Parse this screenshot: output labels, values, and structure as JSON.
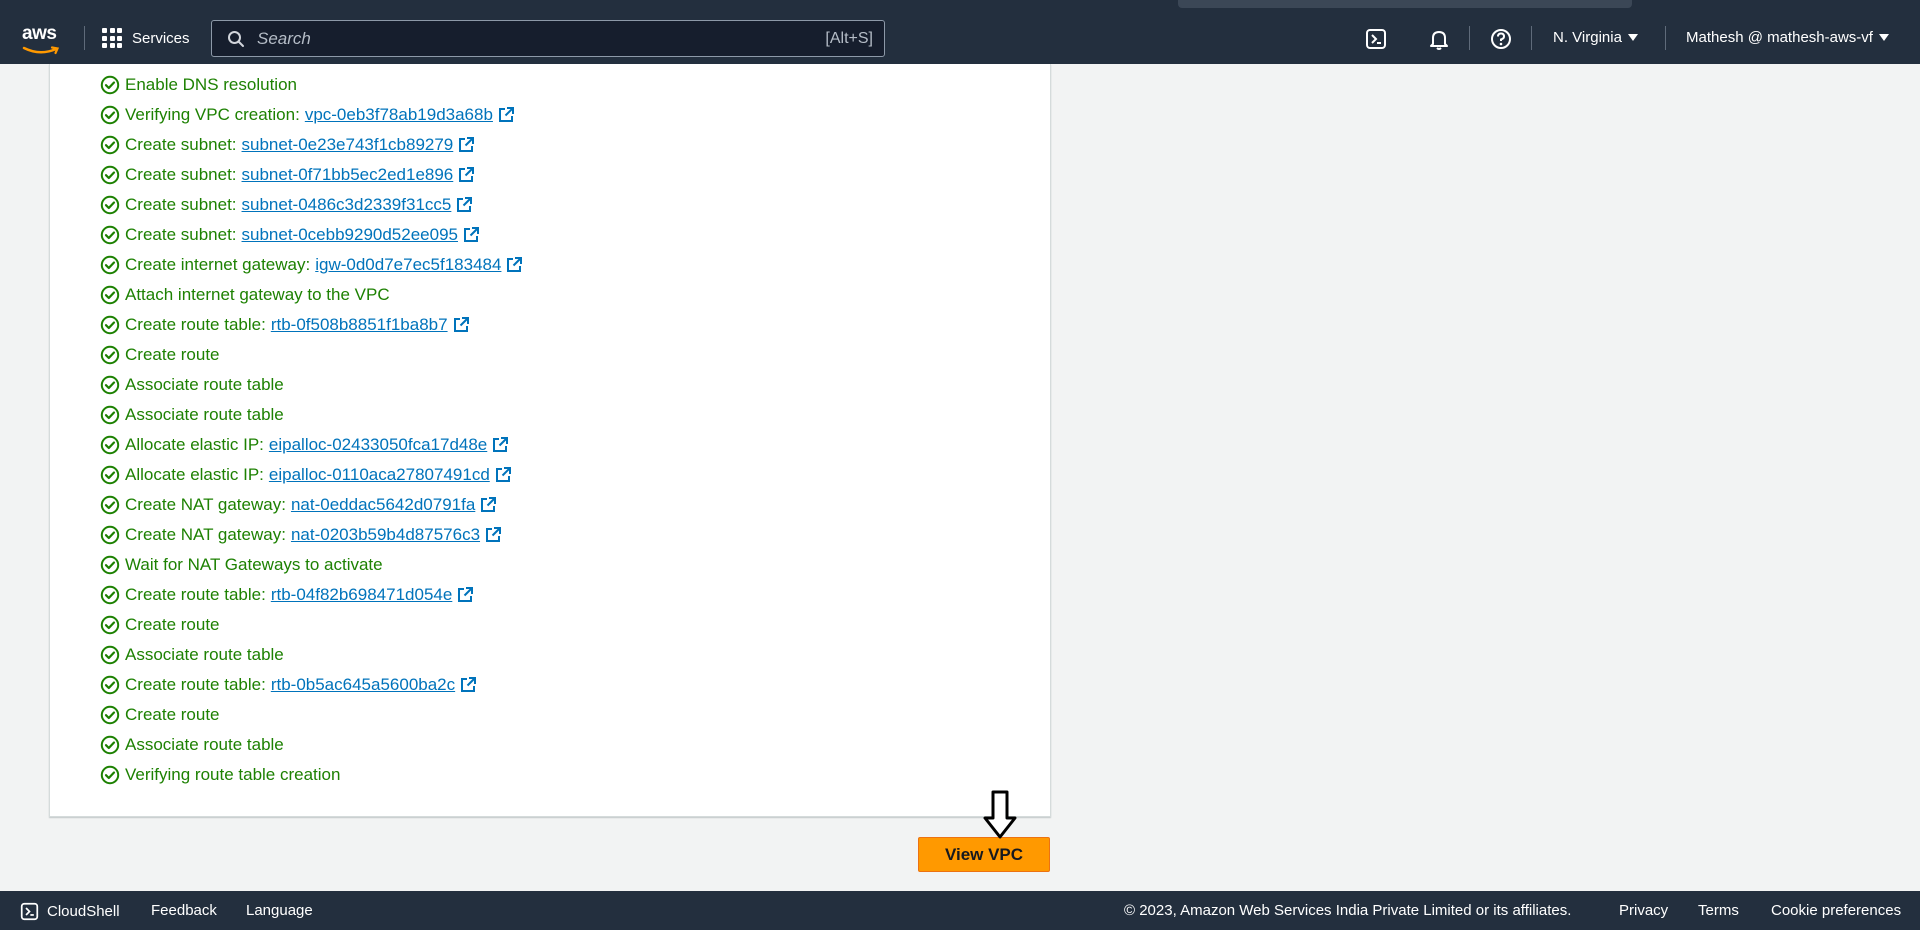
{
  "header": {
    "services_label": "Services",
    "search_placeholder": "Search",
    "search_shortcut": "[Alt+S]",
    "region_label": "N. Virginia",
    "account_label": "Mathesh @ mathesh-aws-vf"
  },
  "steps": [
    {
      "label": "Enable DNS resolution",
      "link": ""
    },
    {
      "label": "Verifying VPC creation:",
      "link": "vpc-0eb3f78ab19d3a68b"
    },
    {
      "label": "Create subnet:",
      "link": "subnet-0e23e743f1cb89279"
    },
    {
      "label": "Create subnet:",
      "link": "subnet-0f71bb5ec2ed1e896"
    },
    {
      "label": "Create subnet:",
      "link": "subnet-0486c3d2339f31cc5"
    },
    {
      "label": "Create subnet:",
      "link": "subnet-0cebb9290d52ee095"
    },
    {
      "label": "Create internet gateway:",
      "link": "igw-0d0d7e7ec5f183484"
    },
    {
      "label": "Attach internet gateway to the VPC",
      "link": ""
    },
    {
      "label": "Create route table:",
      "link": "rtb-0f508b8851f1ba8b7"
    },
    {
      "label": "Create route",
      "link": ""
    },
    {
      "label": "Associate route table",
      "link": ""
    },
    {
      "label": "Associate route table",
      "link": ""
    },
    {
      "label": "Allocate elastic IP:",
      "link": "eipalloc-02433050fca17d48e"
    },
    {
      "label": "Allocate elastic IP:",
      "link": "eipalloc-0110aca27807491cd"
    },
    {
      "label": "Create NAT gateway:",
      "link": "nat-0eddac5642d0791fa"
    },
    {
      "label": "Create NAT gateway:",
      "link": "nat-0203b59b4d87576c3"
    },
    {
      "label": "Wait for NAT Gateways to activate",
      "link": ""
    },
    {
      "label": "Create route table:",
      "link": "rtb-04f82b698471d054e"
    },
    {
      "label": "Create route",
      "link": ""
    },
    {
      "label": "Associate route table",
      "link": ""
    },
    {
      "label": "Create route table:",
      "link": "rtb-0b5ac645a5600ba2c"
    },
    {
      "label": "Create route",
      "link": ""
    },
    {
      "label": "Associate route table",
      "link": ""
    },
    {
      "label": "Verifying route table creation",
      "link": ""
    }
  ],
  "actions": {
    "view_vpc_label": "View VPC"
  },
  "footer": {
    "cloudshell_label": "CloudShell",
    "feedback_label": "Feedback",
    "language_label": "Language",
    "copyright": "© 2023, Amazon Web Services India Private Limited or its affiliates.",
    "privacy_label": "Privacy",
    "terms_label": "Terms",
    "cookie_label": "Cookie preferences"
  },
  "colors": {
    "nav_bg": "#232f3e",
    "success_green": "#1d8102",
    "link_blue": "#0073bb",
    "primary_orange": "#ff9900"
  },
  "icons": {
    "step_status": "success-check-circle-icon",
    "link": "external-link-icon"
  }
}
